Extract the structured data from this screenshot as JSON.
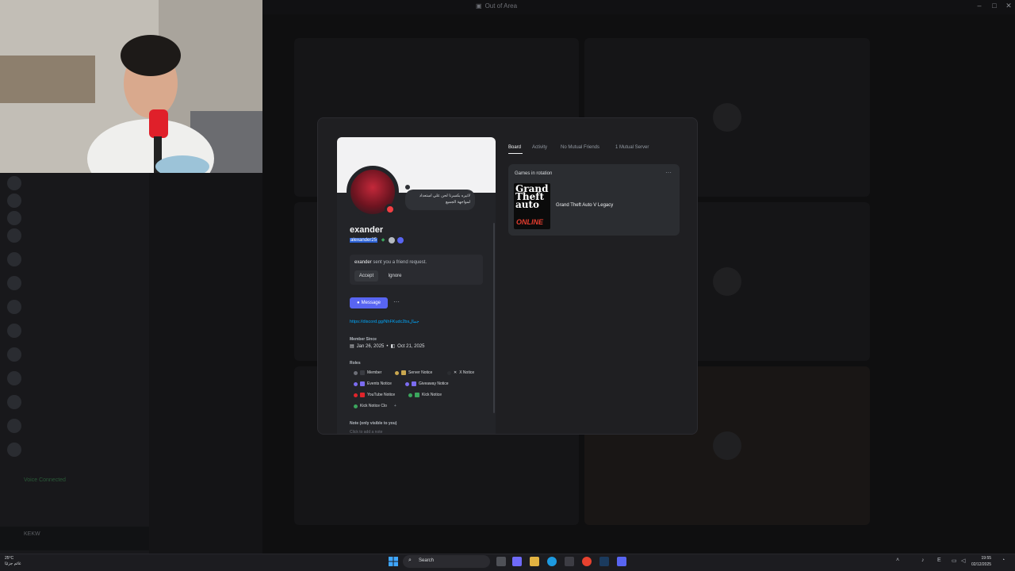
{
  "window": {
    "title": "Out of Area"
  },
  "sidebar": {
    "voice_status": "Voice Connected",
    "current_user": "KEKW"
  },
  "profile": {
    "display_name": "exander",
    "username": "alexander25",
    "status_text": "لاتيره بكسرنا لحن علي استعداد لمواجهة الجميع",
    "friend_request": {
      "sender": "exander",
      "text": "sent you a friend request.",
      "accept_label": "Accept",
      "ignore_label": "Ignore"
    },
    "message_label": "Message",
    "more_label": "···",
    "invite_link": "https://discord.gg/NhFKudc2bs",
    "invite_suffix": "جمال",
    "member_since_label": "Member Since",
    "member_since_discord": "Jan 26, 2025",
    "member_since_server": "Oct 21, 2025",
    "roles_label": "Roles",
    "roles": [
      {
        "name": "Member",
        "color": "#6d6f78"
      },
      {
        "name": "Server Notice",
        "color": "#c9a74f"
      },
      {
        "name": "X Notice",
        "color": "#2b2d31"
      },
      {
        "name": "Events Notice",
        "color": "#7b6cf0"
      },
      {
        "name": "Giveaway Notice",
        "color": "#7b6cf0"
      },
      {
        "name": "YouTube Notice",
        "color": "#e0242b"
      },
      {
        "name": "Kick Notice",
        "color": "#3ba55d"
      },
      {
        "name": "Kick Notice Clo",
        "color": "#3ba55d"
      }
    ],
    "add_role_label": "+",
    "note_label": "Note (only visible to you)",
    "note_placeholder": "Click to add a note"
  },
  "tabs": [
    {
      "label": "Board",
      "active": true
    },
    {
      "label": "Activity",
      "active": false
    },
    {
      "label": "No Mutual Friends",
      "active": false
    },
    {
      "label": "1 Mutual Server",
      "active": false
    }
  ],
  "games": {
    "title": "Games in rotation",
    "more_label": "···",
    "items": [
      {
        "name": "Grand Theft Auto V Legacy",
        "art_lines": [
          "Grand",
          "Theft",
          "auto",
          "ONLINE"
        ]
      }
    ]
  },
  "taskbar": {
    "weather_temp": "25°C",
    "weather_text": "غائم جزئيًا",
    "search_placeholder": "Search",
    "time": "19:55",
    "date": "02/12/2025",
    "lang": "E"
  },
  "colors": {
    "accent": "#5865f2",
    "link": "#00a8fc",
    "status_dnd": "#f23f43"
  }
}
